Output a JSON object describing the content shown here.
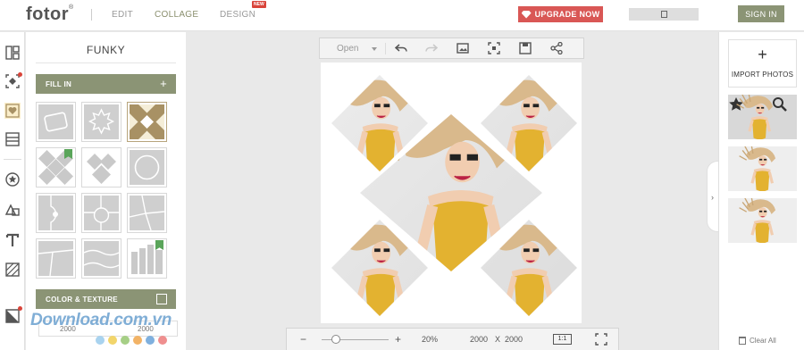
{
  "app": {
    "logo": "fotor",
    "trademark": "®",
    "nav": [
      {
        "label": "EDIT",
        "active": false
      },
      {
        "label": "COLLAGE",
        "active": true
      },
      {
        "label": "DESIGN",
        "active": false
      }
    ],
    "new_badge": "NEW",
    "upgrade_label": "UPGRADE NOW",
    "signin_label": "SIGN IN"
  },
  "left_panel": {
    "title": "FUNKY",
    "fill_in_label": "FILL IN",
    "fill_in_plus": "+",
    "color_texture_label": "COLOR & TEXTURE",
    "width_value": "2000",
    "height_value": "2000",
    "swatches": [
      "#a9d3ef",
      "#f2d56b",
      "#a6cf86",
      "#f2b366",
      "#7fb0de",
      "#ef8f8f"
    ],
    "watermark": "Download.com.vn"
  },
  "toolbar": {
    "open_label": "Open",
    "icons": [
      "undo-icon",
      "redo-icon",
      "image-icon",
      "fit-icon",
      "save-icon",
      "share-icon"
    ]
  },
  "zoom": {
    "minus": "−",
    "plus": "+",
    "level": "20%",
    "level_value": 0.2,
    "width": "2000",
    "x_sep": "X",
    "height": "2000",
    "ratio_label": "1:1"
  },
  "right_panel": {
    "import_plus": "+",
    "import_label": "IMPORT PHOTOS",
    "collapse_arrow": "›",
    "clear_label": "Clear All"
  },
  "colors": {
    "accent": "#8b9475",
    "upgrade": "#d95755",
    "tile_gold": "#a89164",
    "tile_gray": "#c9c9c9",
    "flag_green": "#5aa55a"
  }
}
